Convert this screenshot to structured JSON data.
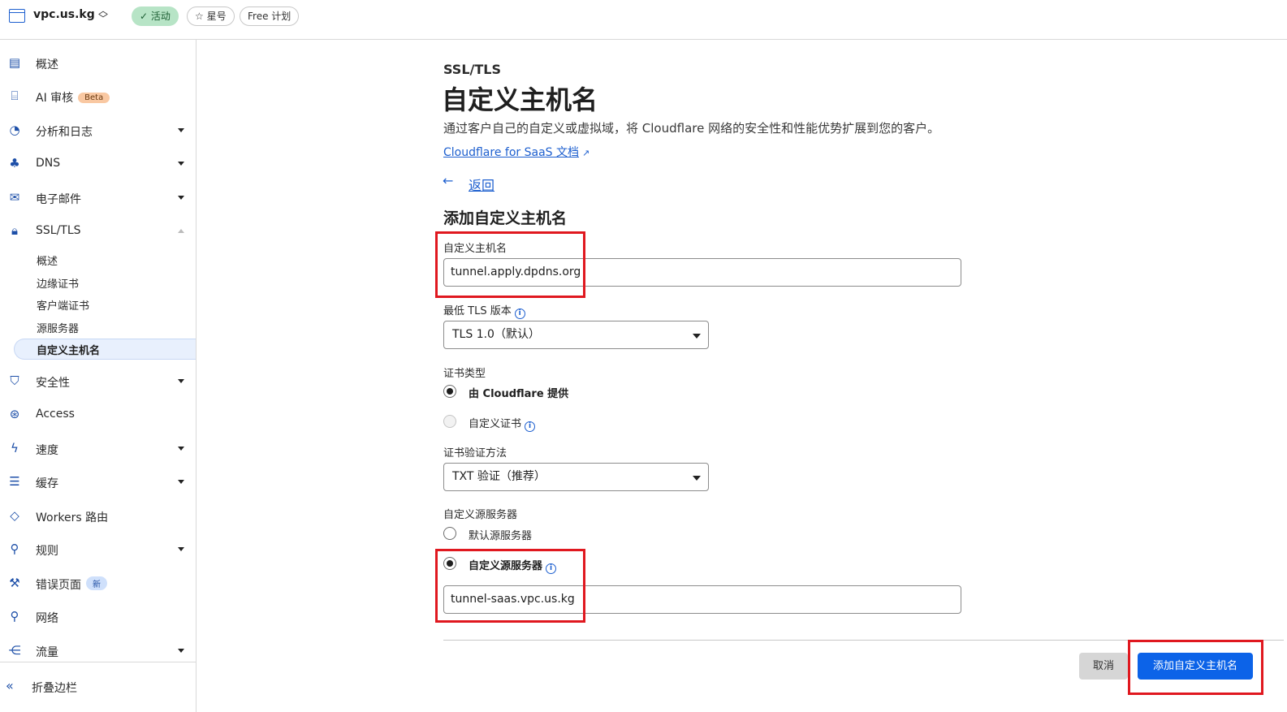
{
  "topbar": {
    "site_name": "vpc.us.kg",
    "status_badge": "✓ 活动",
    "star_label": "☆ 星号",
    "plan_label": "Free 计划"
  },
  "sidebar": {
    "items": [
      {
        "label": "概述",
        "icon": "document-icon"
      },
      {
        "label": "AI 审核",
        "badge": "Beta",
        "icon": "robot-icon"
      },
      {
        "label": "分析和日志",
        "icon": "chart-icon",
        "expandable": true
      },
      {
        "label": "DNS",
        "icon": "network-icon",
        "expandable": true
      },
      {
        "label": "电子邮件",
        "icon": "mail-icon",
        "expandable": true
      },
      {
        "label": "SSL/TLS",
        "icon": "lock-icon",
        "expanded": true
      },
      {
        "label": "安全性",
        "icon": "shield-icon",
        "expandable": true
      },
      {
        "label": "Access",
        "icon": "access-icon"
      },
      {
        "label": "速度",
        "icon": "bolt-icon",
        "expandable": true
      },
      {
        "label": "缓存",
        "icon": "storage-icon",
        "expandable": true
      },
      {
        "label": "Workers 路由",
        "icon": "workers-icon"
      },
      {
        "label": "规则",
        "icon": "rules-icon",
        "expandable": true
      },
      {
        "label": "错误页面",
        "badge": "新",
        "icon": "wrench-icon"
      },
      {
        "label": "网络",
        "icon": "location-icon"
      },
      {
        "label": "流量",
        "icon": "traffic-icon",
        "expandable": true
      }
    ],
    "ssl_sub_items": [
      "概述",
      "边缘证书",
      "客户端证书",
      "源服务器",
      "自定义主机名"
    ],
    "active_sub_item": "自定义主机名",
    "collapse_label": "折叠边栏"
  },
  "main": {
    "section": "SSL/TLS",
    "title": "自定义主机名",
    "description": "通过客户自己的自定义或虚拟域，将 Cloudflare 网络的安全性和性能优势扩展到您的客户。",
    "docs_link": "Cloudflare for SaaS 文档",
    "back_arrow": "←",
    "back_label": "返回",
    "form_title": "添加自定义主机名",
    "hostname_label": "自定义主机名",
    "hostname_value": "tunnel.apply.dpdns.org",
    "tls_label": "最低 TLS 版本",
    "tls_value": "TLS 1.0（默认）",
    "cert_type_label": "证书类型",
    "cert_option_1": "由 Cloudflare 提供",
    "cert_option_2": "自定义证书",
    "verify_label": "证书验证方法",
    "verify_value": "TXT 验证（推荐）",
    "origin_label": "自定义源服务器",
    "origin_option_1": "默认源服务器",
    "origin_option_2": "自定义源服务器",
    "origin_value": "tunnel-saas.vpc.us.kg",
    "cancel_label": "取消",
    "submit_label": "添加自定义主机名"
  },
  "colors": {
    "accent": "#1d5fcf",
    "primary_button": "#0c63e8",
    "highlight_border": "#e0181f",
    "active_badge": "#b7e4c6"
  }
}
